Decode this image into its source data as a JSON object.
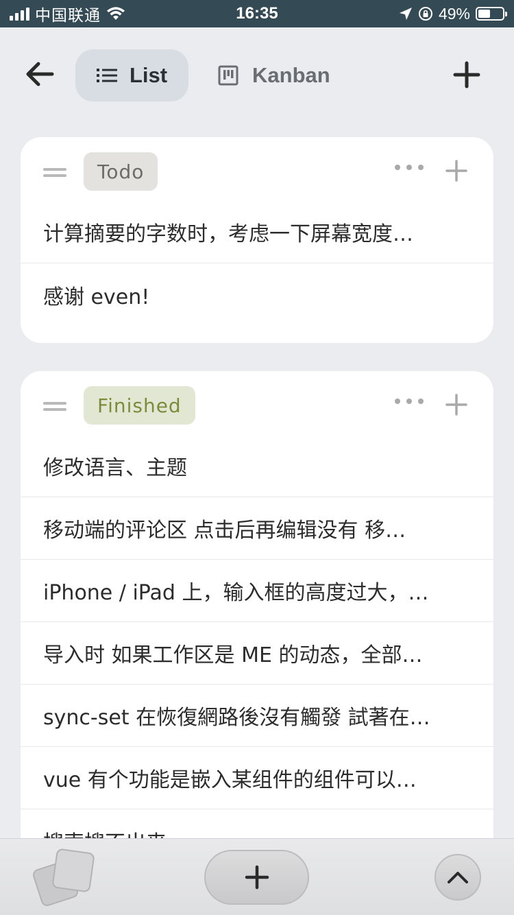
{
  "status_bar": {
    "carrier": "中国联通",
    "time": "16:35",
    "battery": "49%",
    "battery_level": 0.49
  },
  "header": {
    "tabs": [
      {
        "label": "List",
        "icon": "list-icon",
        "active": true
      },
      {
        "label": "Kanban",
        "icon": "kanban-icon",
        "active": false
      }
    ]
  },
  "groups": [
    {
      "tag": "Todo",
      "tag_color": "#6f6b66",
      "tag_bg": "#e4e2df",
      "items": [
        "计算摘要的字数时，考虑一下屏幕宽度…",
        "感谢 even!"
      ]
    },
    {
      "tag": "Finished",
      "tag_color": "#7a8c3a",
      "tag_bg": "#e2e7d4",
      "items": [
        "修改语言、主题",
        "移动端的评论区 点击后再编辑没有 移…",
        "iPhone / iPad 上，输入框的高度过大，…",
        "导入时 如果工作区是 ME 的动态，全部…",
        "sync-set 在恢復網路後沒有觸發 試著在…",
        "vue 有个功能是嵌入某组件的组件可以…",
        "搜索搜不出来"
      ]
    }
  ],
  "colors": {
    "status_bar_bg": "#344a55",
    "page_bg": "#ebecef",
    "active_tab_bg": "#d8dde3"
  }
}
